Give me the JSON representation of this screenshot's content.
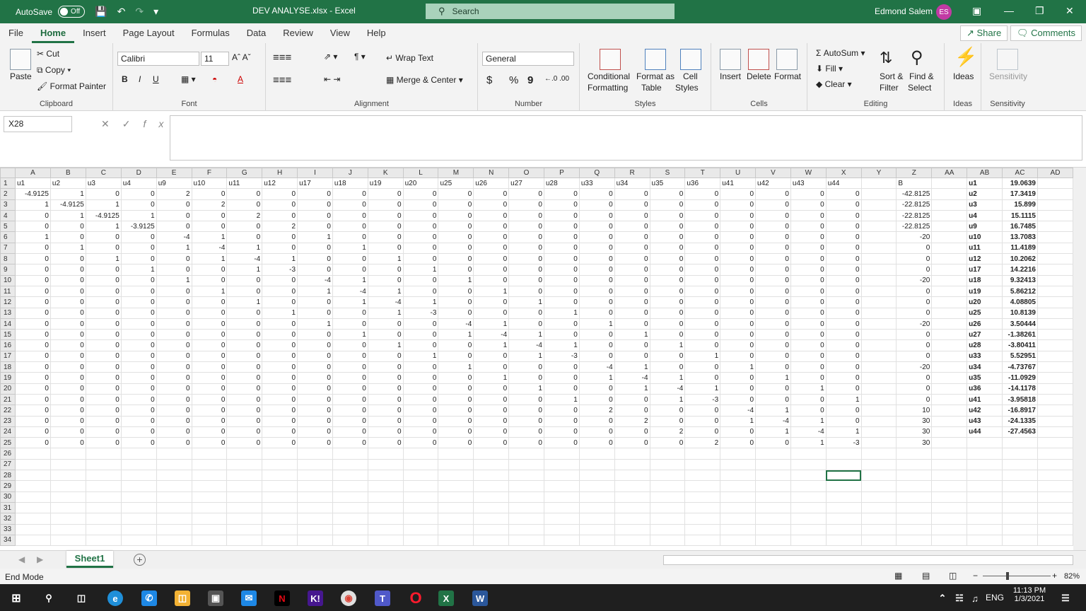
{
  "titlebar": {
    "autosave_label": "AutoSave",
    "autosave_state": "Off",
    "doc_title": "DEV ANALYSE.xlsx  -  Excel",
    "search_placeholder": "Search",
    "user_name": "Edmond Salem",
    "user_initials": "ES"
  },
  "tabs": [
    "File",
    "Home",
    "Insert",
    "Page Layout",
    "Formulas",
    "Data",
    "Review",
    "View",
    "Help"
  ],
  "active_tab": "Home",
  "share_label": "Share",
  "comments_label": "Comments",
  "ribbon": {
    "clipboard": {
      "label": "Clipboard",
      "paste": "Paste",
      "cut": "Cut",
      "copy": "Copy",
      "format_painter": "Format Painter"
    },
    "font": {
      "label": "Font",
      "family": "Calibri",
      "size": "11",
      "bold": "B",
      "italic": "I",
      "underline": "U"
    },
    "alignment": {
      "label": "Alignment",
      "wrap": "Wrap Text",
      "merge": "Merge & Center"
    },
    "number": {
      "label": "Number",
      "format": "General",
      "currency": "$",
      "percent": "%",
      "comma": "9"
    },
    "styles": {
      "label": "Styles",
      "conditional": "Conditional",
      "conditional2": "Formatting",
      "format_table": "Format as",
      "format_table2": "Table",
      "cell_styles": "Cell",
      "cell_styles2": "Styles"
    },
    "cells": {
      "label": "Cells",
      "insert": "Insert",
      "delete": "Delete",
      "format": "Format"
    },
    "editing": {
      "label": "Editing",
      "autosum": "AutoSum",
      "fill": "Fill",
      "clear": "Clear",
      "sort": "Sort &",
      "sort2": "Filter",
      "find": "Find &",
      "find2": "Select"
    },
    "ideas": {
      "label": "Ideas",
      "btn": "Ideas"
    },
    "sensitivity": {
      "label": "Sensitivity",
      "btn": "Sensitivity"
    }
  },
  "formula_bar": {
    "name_box": "X28",
    "fx": "fx",
    "content": ""
  },
  "columns": [
    "A",
    "B",
    "C",
    "D",
    "E",
    "F",
    "G",
    "H",
    "I",
    "J",
    "K",
    "L",
    "M",
    "N",
    "O",
    "P",
    "Q",
    "R",
    "S",
    "T",
    "U",
    "V",
    "W",
    "X",
    "Y",
    "Z",
    "AA",
    "AB",
    "AC",
    "AD"
  ],
  "rows": [
    [
      "u1",
      "u2",
      "u3",
      "u4",
      "u9",
      "u10",
      "u11",
      "u12",
      "u17",
      "u18",
      "u19",
      "u20",
      "u25",
      "u26",
      "u27",
      "u28",
      "u33",
      "u34",
      "u35",
      "u36",
      "u41",
      "u42",
      "u43",
      "u44",
      "",
      "B",
      "",
      "u1",
      "19.0639",
      ""
    ],
    [
      "-4.9125",
      "1",
      "0",
      "0",
      "2",
      "0",
      "0",
      "0",
      "0",
      "0",
      "0",
      "0",
      "0",
      "0",
      "0",
      "0",
      "0",
      "0",
      "0",
      "0",
      "0",
      "0",
      "0",
      "0",
      "",
      "-42.8125",
      "",
      "u2",
      "17.3419",
      ""
    ],
    [
      "1",
      "-4.9125",
      "1",
      "0",
      "0",
      "2",
      "0",
      "0",
      "0",
      "0",
      "0",
      "0",
      "0",
      "0",
      "0",
      "0",
      "0",
      "0",
      "0",
      "0",
      "0",
      "0",
      "0",
      "0",
      "",
      "-22.8125",
      "",
      "u3",
      "15.899",
      ""
    ],
    [
      "0",
      "1",
      "-4.9125",
      "1",
      "0",
      "0",
      "2",
      "0",
      "0",
      "0",
      "0",
      "0",
      "0",
      "0",
      "0",
      "0",
      "0",
      "0",
      "0",
      "0",
      "0",
      "0",
      "0",
      "0",
      "",
      "-22.8125",
      "",
      "u4",
      "15.1115",
      ""
    ],
    [
      "0",
      "0",
      "1",
      "-3.9125",
      "0",
      "0",
      "0",
      "2",
      "0",
      "0",
      "0",
      "0",
      "0",
      "0",
      "0",
      "0",
      "0",
      "0",
      "0",
      "0",
      "0",
      "0",
      "0",
      "0",
      "",
      "-22.8125",
      "",
      "u9",
      "16.7485",
      ""
    ],
    [
      "1",
      "0",
      "0",
      "0",
      "-4",
      "1",
      "0",
      "0",
      "1",
      "0",
      "0",
      "0",
      "0",
      "0",
      "0",
      "0",
      "0",
      "0",
      "0",
      "0",
      "0",
      "0",
      "0",
      "0",
      "",
      "-20",
      "",
      "u10",
      "13.7083",
      ""
    ],
    [
      "0",
      "1",
      "0",
      "0",
      "1",
      "-4",
      "1",
      "0",
      "0",
      "1",
      "0",
      "0",
      "0",
      "0",
      "0",
      "0",
      "0",
      "0",
      "0",
      "0",
      "0",
      "0",
      "0",
      "0",
      "",
      "0",
      "",
      "u11",
      "11.4189",
      ""
    ],
    [
      "0",
      "0",
      "1",
      "0",
      "0",
      "1",
      "-4",
      "1",
      "0",
      "0",
      "1",
      "0",
      "0",
      "0",
      "0",
      "0",
      "0",
      "0",
      "0",
      "0",
      "0",
      "0",
      "0",
      "0",
      "",
      "0",
      "",
      "u12",
      "10.2062",
      ""
    ],
    [
      "0",
      "0",
      "0",
      "1",
      "0",
      "0",
      "1",
      "-3",
      "0",
      "0",
      "0",
      "1",
      "0",
      "0",
      "0",
      "0",
      "0",
      "0",
      "0",
      "0",
      "0",
      "0",
      "0",
      "0",
      "",
      "0",
      "",
      "u17",
      "14.2216",
      ""
    ],
    [
      "0",
      "0",
      "0",
      "0",
      "1",
      "0",
      "0",
      "0",
      "-4",
      "1",
      "0",
      "0",
      "1",
      "0",
      "0",
      "0",
      "0",
      "0",
      "0",
      "0",
      "0",
      "0",
      "0",
      "0",
      "",
      "-20",
      "",
      "u18",
      "9.32413",
      ""
    ],
    [
      "0",
      "0",
      "0",
      "0",
      "0",
      "1",
      "0",
      "0",
      "1",
      "-4",
      "1",
      "0",
      "0",
      "1",
      "0",
      "0",
      "0",
      "0",
      "0",
      "0",
      "0",
      "0",
      "0",
      "0",
      "",
      "0",
      "",
      "u19",
      "5.86212",
      ""
    ],
    [
      "0",
      "0",
      "0",
      "0",
      "0",
      "0",
      "1",
      "0",
      "0",
      "1",
      "-4",
      "1",
      "0",
      "0",
      "1",
      "0",
      "0",
      "0",
      "0",
      "0",
      "0",
      "0",
      "0",
      "0",
      "",
      "0",
      "",
      "u20",
      "4.08805",
      ""
    ],
    [
      "0",
      "0",
      "0",
      "0",
      "0",
      "0",
      "0",
      "1",
      "0",
      "0",
      "1",
      "-3",
      "0",
      "0",
      "0",
      "1",
      "0",
      "0",
      "0",
      "0",
      "0",
      "0",
      "0",
      "0",
      "",
      "0",
      "",
      "u25",
      "10.8139",
      ""
    ],
    [
      "0",
      "0",
      "0",
      "0",
      "0",
      "0",
      "0",
      "0",
      "1",
      "0",
      "0",
      "0",
      "-4",
      "1",
      "0",
      "0",
      "1",
      "0",
      "0",
      "0",
      "0",
      "0",
      "0",
      "0",
      "",
      "-20",
      "",
      "u26",
      "3.50444",
      ""
    ],
    [
      "0",
      "0",
      "0",
      "0",
      "0",
      "0",
      "0",
      "0",
      "0",
      "1",
      "0",
      "0",
      "1",
      "-4",
      "1",
      "0",
      "0",
      "1",
      "0",
      "0",
      "0",
      "0",
      "0",
      "0",
      "",
      "0",
      "",
      "u27",
      "-1.38261",
      ""
    ],
    [
      "0",
      "0",
      "0",
      "0",
      "0",
      "0",
      "0",
      "0",
      "0",
      "0",
      "1",
      "0",
      "0",
      "1",
      "-4",
      "1",
      "0",
      "0",
      "1",
      "0",
      "0",
      "0",
      "0",
      "0",
      "",
      "0",
      "",
      "u28",
      "-3.80411",
      ""
    ],
    [
      "0",
      "0",
      "0",
      "0",
      "0",
      "0",
      "0",
      "0",
      "0",
      "0",
      "0",
      "1",
      "0",
      "0",
      "1",
      "-3",
      "0",
      "0",
      "0",
      "1",
      "0",
      "0",
      "0",
      "0",
      "",
      "0",
      "",
      "u33",
      "5.52951",
      ""
    ],
    [
      "0",
      "0",
      "0",
      "0",
      "0",
      "0",
      "0",
      "0",
      "0",
      "0",
      "0",
      "0",
      "1",
      "0",
      "0",
      "0",
      "-4",
      "1",
      "0",
      "0",
      "1",
      "0",
      "0",
      "0",
      "",
      "-20",
      "",
      "u34",
      "-4.73767",
      ""
    ],
    [
      "0",
      "0",
      "0",
      "0",
      "0",
      "0",
      "0",
      "0",
      "0",
      "0",
      "0",
      "0",
      "0",
      "1",
      "0",
      "0",
      "1",
      "-4",
      "1",
      "0",
      "0",
      "1",
      "0",
      "0",
      "",
      "0",
      "",
      "u35",
      "-11.0929",
      ""
    ],
    [
      "0",
      "0",
      "0",
      "0",
      "0",
      "0",
      "0",
      "0",
      "0",
      "0",
      "0",
      "0",
      "0",
      "0",
      "1",
      "0",
      "0",
      "1",
      "-4",
      "1",
      "0",
      "0",
      "1",
      "0",
      "",
      "0",
      "",
      "u36",
      "-14.1178",
      ""
    ],
    [
      "0",
      "0",
      "0",
      "0",
      "0",
      "0",
      "0",
      "0",
      "0",
      "0",
      "0",
      "0",
      "0",
      "0",
      "0",
      "1",
      "0",
      "0",
      "1",
      "-3",
      "0",
      "0",
      "0",
      "1",
      "",
      "0",
      "",
      "u41",
      "-3.95818",
      ""
    ],
    [
      "0",
      "0",
      "0",
      "0",
      "0",
      "0",
      "0",
      "0",
      "0",
      "0",
      "0",
      "0",
      "0",
      "0",
      "0",
      "0",
      "2",
      "0",
      "0",
      "0",
      "-4",
      "1",
      "0",
      "0",
      "",
      "10",
      "",
      "u42",
      "-16.8917",
      ""
    ],
    [
      "0",
      "0",
      "0",
      "0",
      "0",
      "0",
      "0",
      "0",
      "0",
      "0",
      "0",
      "0",
      "0",
      "0",
      "0",
      "0",
      "0",
      "2",
      "0",
      "0",
      "1",
      "-4",
      "1",
      "0",
      "",
      "30",
      "",
      "u43",
      "-24.1335",
      ""
    ],
    [
      "0",
      "0",
      "0",
      "0",
      "0",
      "0",
      "0",
      "0",
      "0",
      "0",
      "0",
      "0",
      "0",
      "0",
      "0",
      "0",
      "0",
      "0",
      "2",
      "0",
      "0",
      "1",
      "-4",
      "1",
      "",
      "30",
      "",
      "u44",
      "-27.4563",
      ""
    ],
    [
      "0",
      "0",
      "0",
      "0",
      "0",
      "0",
      "0",
      "0",
      "0",
      "0",
      "0",
      "0",
      "0",
      "0",
      "0",
      "0",
      "0",
      "0",
      "0",
      "2",
      "0",
      "0",
      "1",
      "-3",
      "",
      "30",
      "",
      "",
      "",
      ""
    ]
  ],
  "empty_rows": [
    26,
    27,
    28,
    29,
    30,
    31,
    32,
    33,
    34
  ],
  "sheet_tab": "Sheet1",
  "status": {
    "mode": "End Mode",
    "zoom": "82%"
  },
  "taskbar": {
    "lang": "ENG",
    "time": "11:13 PM",
    "date": "1/3/2021"
  }
}
